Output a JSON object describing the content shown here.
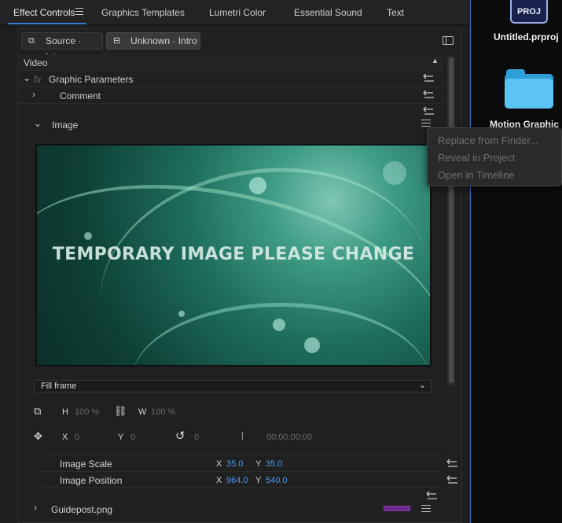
{
  "tabs": [
    {
      "label": "Effect Controls",
      "active": true
    },
    {
      "label": "Graphics Templates"
    },
    {
      "label": "Lumetri Color"
    },
    {
      "label": "Essential Sound"
    },
    {
      "label": "Text"
    }
  ],
  "clipbar": {
    "source_label": "Source · Intro",
    "target_label": "Unknown · Intro"
  },
  "section": {
    "video_label": "Video",
    "fx_label": "fx",
    "graphic_params_label": "Graphic Parameters",
    "comment_label": "Comment",
    "image_label": "Image"
  },
  "preview": {
    "overlay_text": "TEMPORARY IMAGE PLEASE CHANGE"
  },
  "fill_select": {
    "value": "Fill frame"
  },
  "size_controls": {
    "h_label": "H",
    "h_value": "100 %",
    "w_label": "W",
    "w_value": "100 %"
  },
  "position_controls": {
    "x_label": "X",
    "x_value": "0",
    "y_label": "Y",
    "y_value": "0",
    "rotation_value": "0",
    "timecode": "00;00;00;00"
  },
  "image_scale": {
    "label": "Image Scale",
    "x_label": "X",
    "x_value": "35.0",
    "y_label": "Y",
    "y_value": "35.0"
  },
  "image_position": {
    "label": "Image Position",
    "x_label": "X",
    "x_value": "964.0",
    "y_label": "Y",
    "y_value": "540.0"
  },
  "guidepost": {
    "label": "Guidepost.png",
    "swatch_color": "#6e2a8c"
  },
  "context_menu": {
    "items": [
      "Replace from Finder...",
      "Reveal in Project",
      "Open in Timeline"
    ]
  },
  "desktop": {
    "proj_icon_text": "PROJ",
    "proj_file_label": "Untitled.prproj",
    "folder_label": "Motion Graphic"
  },
  "colors": {
    "accent": "#3d7ae0",
    "value_blue": "#4a9bf0"
  }
}
